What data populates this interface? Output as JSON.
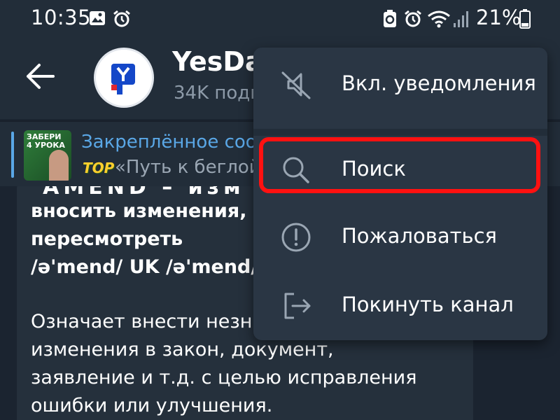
{
  "status_bar": {
    "time": "10:35",
    "battery_percent": "21%",
    "icons": [
      "image-icon",
      "alarm-icon",
      "data-saver-icon",
      "alarm-icon",
      "wifi-icon",
      "signal-icon",
      "battery-icon"
    ]
  },
  "header": {
    "title": "YesDai",
    "subtitle": "34K подп"
  },
  "pinned": {
    "title": "Закреплённое соо",
    "badge": "TOP",
    "text": "«Путь к беглой",
    "thumbnail_text": "ЗАБЕРИ\n4 УРОКА"
  },
  "message": {
    "lines": [
      "вносить изменения,",
      "пересмотреть",
      "/ə'mend/ UK /ə'mend/",
      "Означает внести незн",
      "изменения в закон, документ,",
      "заявление и т.д. с целью исправления",
      "ошибки или улучшения."
    ],
    "top_partial": "ˈAMEND – изм"
  },
  "menu": {
    "items": [
      {
        "label": "Вкл. уведомления",
        "icon": "bell-muted-icon"
      },
      {
        "label": "Поиск",
        "icon": "search-icon"
      },
      {
        "label": "Пожаловаться",
        "icon": "report-icon"
      },
      {
        "label": "Покинуть канал",
        "icon": "leave-icon"
      }
    ]
  },
  "colors": {
    "accent": "#5aa7e6",
    "highlight": "#ff1111",
    "menu_bg": "#2a3644",
    "header_bg": "#222d39"
  }
}
